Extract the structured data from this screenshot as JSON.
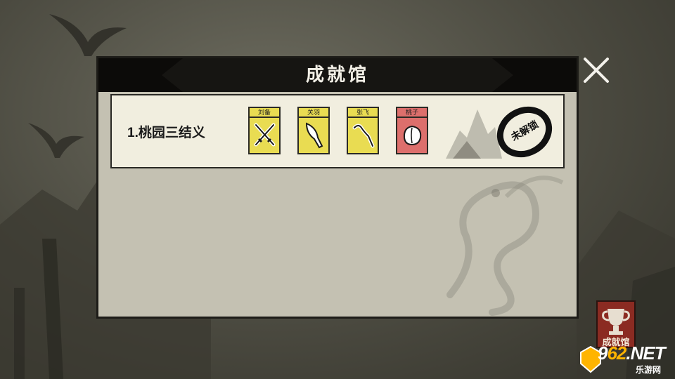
{
  "panel": {
    "title": "成就馆",
    "close_icon": "close-icon"
  },
  "achievements": [
    {
      "title": "1.桃园三结义",
      "cards": [
        {
          "label": "刘备",
          "color": "#e9dc52",
          "icon": "crossed-swords-icon"
        },
        {
          "label": "关羽",
          "color": "#e9dc52",
          "icon": "glaive-icon"
        },
        {
          "label": "张飞",
          "color": "#e9dc52",
          "icon": "serpent-spear-icon"
        },
        {
          "label": "桃子",
          "color": "#dd6f6c",
          "icon": "peach-icon"
        }
      ],
      "status": "未解锁"
    }
  ],
  "trophy_button": {
    "label": "成就馆",
    "icon": "trophy-icon",
    "color": "#8b2b22"
  },
  "watermark": {
    "main_prefix": "9",
    "main_highlight": "62",
    "main_suffix": ".NET",
    "sub": "乐游网"
  }
}
